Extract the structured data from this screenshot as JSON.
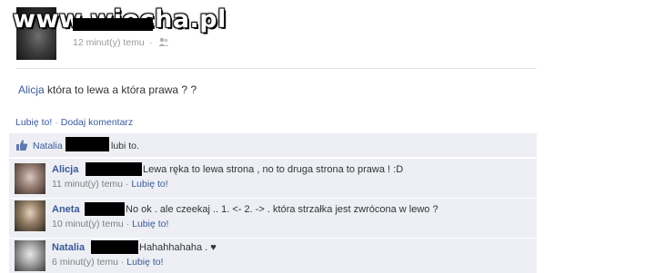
{
  "watermark": "www.wiocha.pl",
  "post": {
    "timestamp": "12 minut(y) temu",
    "separator": "·",
    "author": "Alicja",
    "text": "która to lewa a która prawa ? ?"
  },
  "actions": {
    "like": "Lubię to!",
    "dot": "·",
    "comment": "Dodaj komentarz"
  },
  "likes": {
    "name": "Natalia",
    "suffix": "lubi to."
  },
  "comments": [
    {
      "author": "Alicja",
      "text": "Lewa ręka to lewa strona , no to druga strona to prawa ! :D",
      "time": "11 minut(y) temu",
      "dot": "·",
      "like": "Lubię to!"
    },
    {
      "author": "Aneta",
      "text": "No ok . ale czeekaj .. 1. <- 2. -> . która strzałka jest zwrócona w lewo ?",
      "time": "10 minut(y) temu",
      "dot": "·",
      "like": "Lubię to!"
    },
    {
      "author": "Natalia",
      "text": "Hahahhahaha . ♥",
      "time": "6 minut(y) temu",
      "dot": "·",
      "like": "Lubię to!"
    }
  ],
  "colors": {
    "link": "#3b5998",
    "block_bg": "#edeff4",
    "meta_grey": "#808080"
  }
}
